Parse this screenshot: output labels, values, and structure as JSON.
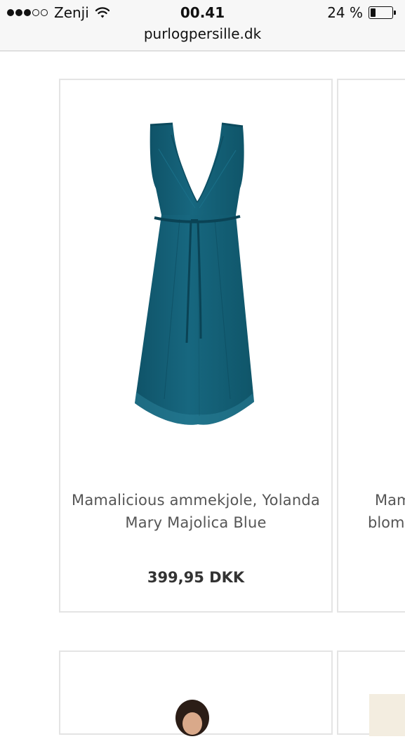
{
  "status_bar": {
    "signal_bars_filled": 3,
    "signal_bars_total": 5,
    "carrier": "Zenji",
    "time": "00.41",
    "battery_text": "24 %",
    "battery_level": 0.24
  },
  "browser": {
    "url": "purlogpersille.dk"
  },
  "products": [
    {
      "name_line_1": "Mamalicious ammekjole, Yolanda",
      "name_line_2": "Mary Majolica Blue",
      "price": "399,95 DKK",
      "image_color": "#15617a"
    },
    {
      "name_line_1": "Mam",
      "name_line_2": "blom"
    }
  ],
  "colors": {
    "card_border": "#e4e4e4",
    "name_text": "#555555",
    "price_text": "#333333"
  }
}
